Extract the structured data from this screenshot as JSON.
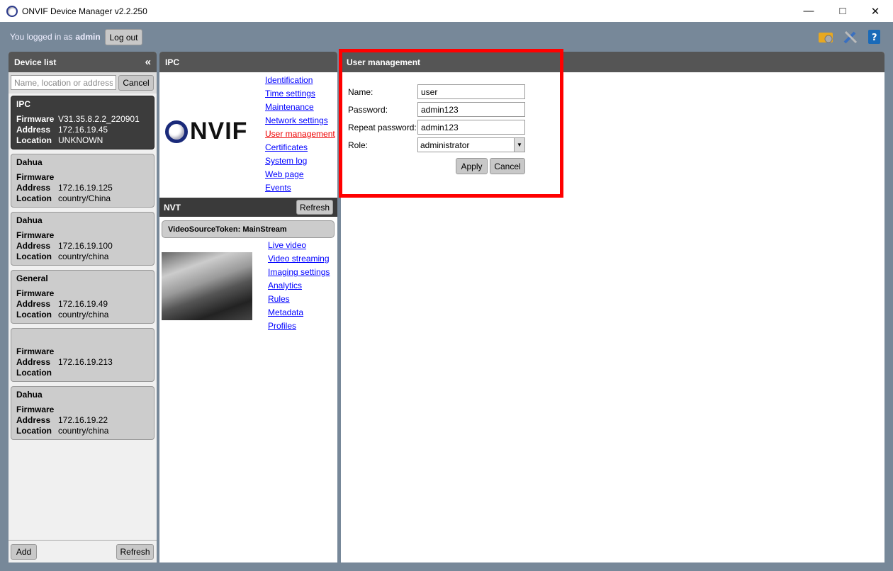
{
  "window": {
    "title": "ONVIF Device Manager v2.2.250"
  },
  "topbar": {
    "logged_in_prefix": "You logged in as",
    "user": "admin",
    "logout_label": "Log out"
  },
  "device_list": {
    "title": "Device list",
    "search_placeholder": "Name, location or address",
    "cancel_label": "Cancel",
    "labels": {
      "firmware": "Firmware",
      "address": "Address",
      "location": "Location"
    },
    "devices": [
      {
        "name": "IPC",
        "firmware": "V31.35.8.2.2_220901",
        "address": "172.16.19.45",
        "location": "UNKNOWN",
        "selected": true
      },
      {
        "name": "Dahua",
        "firmware": "",
        "address": "172.16.19.125",
        "location": "country/China"
      },
      {
        "name": "Dahua",
        "firmware": "",
        "address": "172.16.19.100",
        "location": "country/china"
      },
      {
        "name": "General",
        "firmware": "",
        "address": "172.16.19.49",
        "location": "country/china"
      },
      {
        "name": "",
        "firmware": "",
        "address": "172.16.19.213",
        "location": ""
      },
      {
        "name": "Dahua",
        "firmware": "",
        "address": "172.16.19.22",
        "location": "country/china"
      }
    ],
    "add_label": "Add",
    "refresh_label": "Refresh"
  },
  "ipc": {
    "title": "IPC",
    "logo_text": "ONVIF",
    "links": [
      "Identification",
      "Time settings",
      "Maintenance",
      "Network settings",
      "User management",
      "Certificates",
      "System log",
      "Web page",
      "Events"
    ],
    "active_link": "User management"
  },
  "nvt": {
    "title": "NVT",
    "refresh_label": "Refresh",
    "video_source": "VideoSourceToken: MainStream",
    "links": [
      "Live video",
      "Video streaming",
      "Imaging settings",
      "Analytics",
      "Rules",
      "Metadata",
      "Profiles"
    ]
  },
  "user_management": {
    "title": "User management",
    "name_label": "Name:",
    "name_value": "user",
    "password_label": "Password:",
    "password_value": "admin123",
    "repeat_label": "Repeat password:",
    "repeat_value": "admin123",
    "role_label": "Role:",
    "role_value": "administrator",
    "apply_label": "Apply",
    "cancel_label": "Cancel"
  },
  "colors": {
    "background": "#778899",
    "header": "#555555",
    "link": "#0000ff",
    "active_link": "#ee0000",
    "highlight": "#ff0000"
  }
}
